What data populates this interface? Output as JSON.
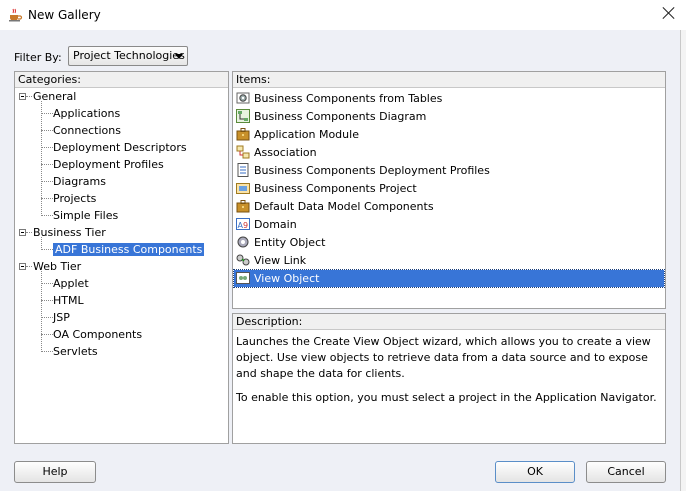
{
  "window": {
    "title": "New Gallery"
  },
  "filter": {
    "label": "Filter By:",
    "selected": "Project Technologies"
  },
  "categories": {
    "header": "Categories:",
    "groups": [
      {
        "label": "General",
        "children": [
          "Applications",
          "Connections",
          "Deployment Descriptors",
          "Deployment Profiles",
          "Diagrams",
          "Projects",
          "Simple Files"
        ]
      },
      {
        "label": "Business Tier",
        "children": [
          "ADF Business Components"
        ]
      },
      {
        "label": "Web Tier",
        "children": [
          "Applet",
          "HTML",
          "JSP",
          "OA Components",
          "Servlets"
        ]
      }
    ],
    "selected": "ADF Business Components"
  },
  "items": {
    "header": "Items:",
    "list": [
      {
        "label": "Business Components from Tables",
        "icon": "gear-table-icon"
      },
      {
        "label": "Business Components Diagram",
        "icon": "diagram-icon"
      },
      {
        "label": "Application Module",
        "icon": "briefcase-icon"
      },
      {
        "label": "Association",
        "icon": "association-icon"
      },
      {
        "label": "Business Components Deployment Profiles",
        "icon": "deployment-profile-icon"
      },
      {
        "label": "Business Components Project",
        "icon": "project-icon"
      },
      {
        "label": "Default Data Model Components",
        "icon": "briefcase-icon"
      },
      {
        "label": "Domain",
        "icon": "domain-icon"
      },
      {
        "label": "Entity Object",
        "icon": "entity-object-icon"
      },
      {
        "label": "View Link",
        "icon": "view-link-icon"
      },
      {
        "label": "View Object",
        "icon": "view-object-icon"
      }
    ],
    "selected": "View Object"
  },
  "description": {
    "header": "Description:",
    "para1": "Launches the Create View Object wizard, which allows you to create a view object. Use view objects to retrieve data from a data source and to expose and shape the data for clients.",
    "para2": "To enable this option, you must select a project in the Application Navigator."
  },
  "buttons": {
    "help": "Help",
    "ok": "OK",
    "cancel": "Cancel"
  },
  "colors": {
    "selection": "#3875d7",
    "dialog_bg": "#eef0f6"
  }
}
